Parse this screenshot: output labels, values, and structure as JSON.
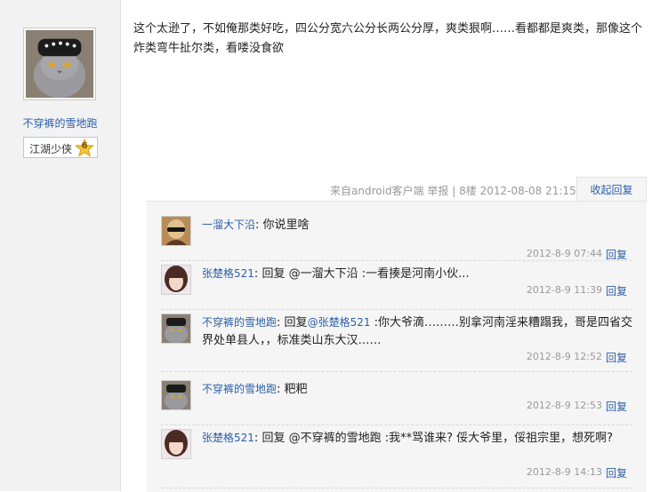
{
  "author": {
    "name": "不穿裤的雪地跑",
    "rank_title": "江湖少侠",
    "rank_level": "6"
  },
  "post": {
    "content": "这个太逊了，不如俺那类好吃，四公分宽六公分长两公分厚，爽类狠啊……看都都是爽类，那像这个炸类弯牛扯尔类，看喽没食欲",
    "source_prefix": "来自",
    "source_link": "android客户端",
    "report": "举报",
    "floor": "8楼",
    "datetime": "2012-08-08 21:15",
    "collapse_label": "收起回复"
  },
  "replies": [
    {
      "user": "一溜大下沿",
      "separator": ":",
      "text": "你说里啥",
      "time": "2012-8-9 07:44",
      "reply_label": "回复"
    },
    {
      "user": "张楚格521",
      "separator": ":",
      "text": "回复 @一溜大下沿 :一看揍是河南小伙...",
      "time": "2012-8-9 11:39",
      "reply_label": "回复"
    },
    {
      "user": "不穿裤的雪地跑",
      "separator": ":",
      "text_prefix": "回复",
      "mention": "@张楚格521",
      "text": " :你大爷滴………别拿河南淫来糟蹋我，哥是四省交界处单县人，，标准类山东大汉……",
      "time": "2012-8-9 12:52",
      "reply_label": "回复"
    },
    {
      "user": "不穿裤的雪地跑",
      "separator": ":",
      "text": "粑粑",
      "time": "2012-8-9 12:53",
      "reply_label": "回复"
    },
    {
      "user": "张楚格521",
      "separator": ":",
      "text": "回复 @不穿裤的雪地跑 :我**骂谁来? 俀大爷里，俀祖宗里，想死啊?",
      "time": "2012-8-9 14:13",
      "reply_label": "回复"
    }
  ]
}
